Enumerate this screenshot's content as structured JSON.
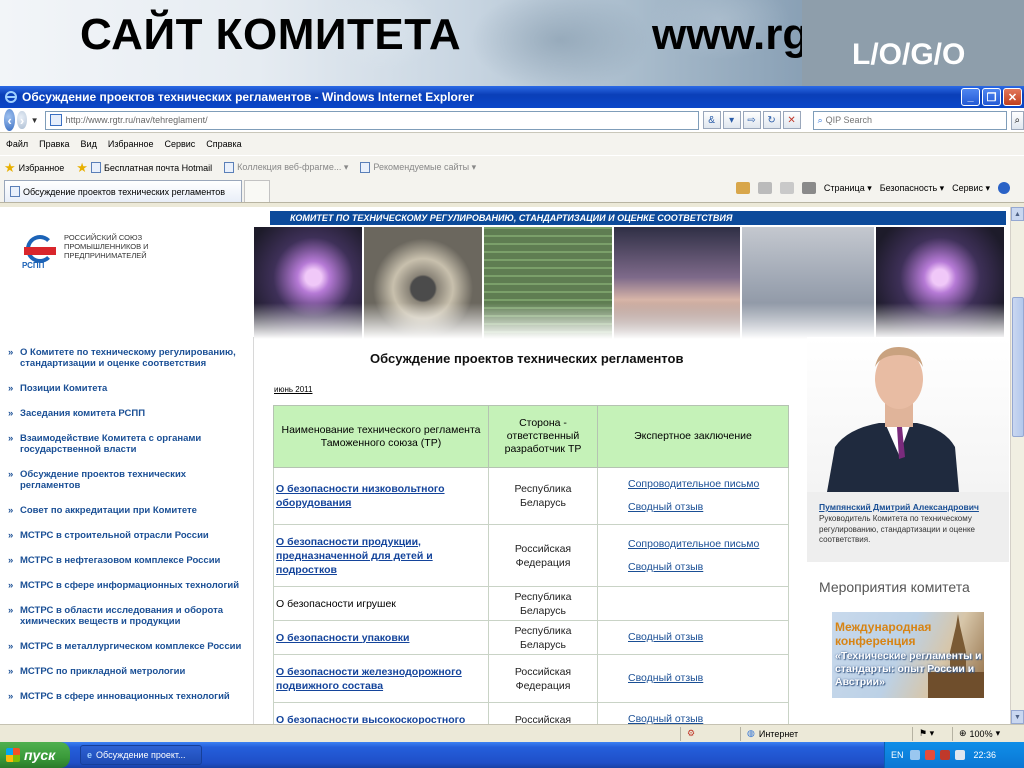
{
  "slide": {
    "title": "САЙТ КОМИТЕТА",
    "url": "www.rgtr.ru",
    "logo": "L/O/G/O"
  },
  "browser": {
    "window_title": "Обсуждение проектов технических регламентов - Windows Internet Explorer",
    "address": "http://www.rgtr.ru/nav/tehreglament/",
    "search_placeholder": "QIP Search",
    "menu": [
      "Файл",
      "Правка",
      "Вид",
      "Избранное",
      "Сервис",
      "Справка"
    ],
    "favorites": {
      "label": "Избранное",
      "items": [
        "Бесплатная почта Hotmail",
        "Коллекция веб-фрагме... ▾",
        "Рекомендуемые сайты ▾"
      ]
    },
    "tab_title": "Обсуждение проектов технических регламентов",
    "command_bar": [
      "Страница ▾",
      "Безопасность ▾",
      "Сервис ▾"
    ],
    "status": {
      "zone": "Интернет",
      "zoom": "100%"
    }
  },
  "site": {
    "org_name": "Российский союз промышленников и предпринимателей",
    "org_abbr": "РСПП",
    "banner": "КОМИТЕТ ПО ТЕХНИЧЕСКОМУ РЕГУЛИРОВАНИЮ, СТАНДАРТИЗАЦИИ И ОЦЕНКЕ СООТВЕТСТВИЯ",
    "nav": [
      "О Комитете по техническому регулированию, стандартизации и оценке соответствия",
      "Позиции Комитета",
      "Заседания комитета РСПП",
      "Взаимодействие Комитета с органами государственной власти",
      "Обсуждение проектов технических регламентов",
      "Совет по аккредитации при Комитете",
      "МСТРС в строительной отрасли России",
      "МСТРС в нефтегазовом комплексе России",
      "МСТРС в сфере информационных технологий",
      "МСТРС в области исследования и оборота химических веществ и продукции",
      "МСТРС в металлургическом комплексе России",
      "МСТРС по прикладной метрологии",
      "МСТРС в сфере инновационных технологий"
    ],
    "page_title": "Обсуждение проектов технических регламентов",
    "date_link": "июнь 2011",
    "table": {
      "headers": [
        "Наименование технического регламента Таможенного союза (ТР)",
        "Сторона - ответственный разработчик ТР",
        "Экспертное заключение"
      ],
      "rows": [
        {
          "name": "О безопасности низковольтного оборудования",
          "linked": true,
          "side": "Республика Беларусь",
          "links": [
            "Сопроводительное письмо",
            "Сводный отзыв"
          ]
        },
        {
          "name": "О безопасности продукции, предназначенной для детей и подростков",
          "linked": true,
          "side": "Российская Федерация",
          "links": [
            "Сопроводительное письмо",
            "Сводный отзыв"
          ]
        },
        {
          "name": "О безопасности игрушек",
          "linked": false,
          "side": "Республика Беларусь",
          "links": []
        },
        {
          "name": "О безопасности упаковки",
          "linked": true,
          "side": "Республика Беларусь",
          "links": [
            "Сводный отзыв"
          ]
        },
        {
          "name": "О безопасности железнодорожного подвижного состава",
          "linked": true,
          "side": "Российская Федерация",
          "links": [
            "Сводный отзыв"
          ]
        },
        {
          "name": "О безопасности высокоскоростного",
          "linked": true,
          "side": "Российская",
          "links": [
            "Сводный отзыв"
          ]
        }
      ]
    },
    "head": {
      "name": "Пумпянский Дмитрий Александрович",
      "role": "Руководитель Комитета по техническому регулированию, стандартизации и оценке соответствия."
    },
    "events_title": "Мероприятия комитета",
    "conference": {
      "line1": "Международная конференция",
      "line2": "«Технические регламенты и стандарты: опыт России и Австрии»"
    }
  },
  "taskbar": {
    "start": "пуск",
    "task": "Обсуждение проект...",
    "lang": "EN",
    "clock": "22:36"
  },
  "colors": {
    "ie_title": "#0a46c8",
    "site_blue": "#0c4a9a",
    "table_header": "#c5f2b8",
    "link": "#14449b"
  }
}
